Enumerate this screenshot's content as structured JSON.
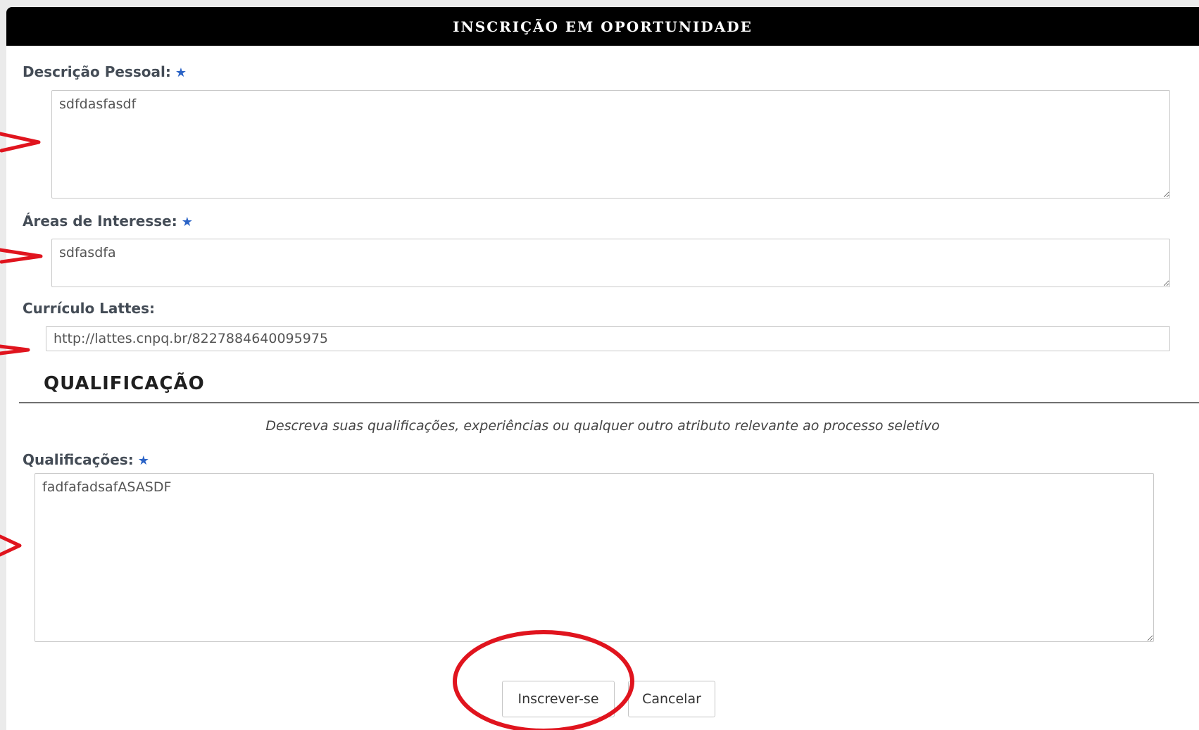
{
  "header": {
    "title": "INSCRIÇÃO EM OPORTUNIDADE"
  },
  "form": {
    "personal_description": {
      "label": "Descrição Pessoal:",
      "required_mark": "★",
      "value": "sdfdasfasdf"
    },
    "areas_of_interest": {
      "label": "Áreas de Interesse:",
      "required_mark": "★",
      "value": "sdfasdfa"
    },
    "lattes": {
      "label": "Currículo Lattes:",
      "value": "http://lattes.cnpq.br/8227884640095975"
    },
    "qualification_section": {
      "title": "QUALIFICAÇÃO",
      "note": "Descreva suas qualificações, experiências ou qualquer outro atributo relevante ao processo seletivo"
    },
    "qualifications": {
      "label": "Qualificações:",
      "required_mark": "★",
      "value": "fadfafadsafASASDF"
    }
  },
  "actions": {
    "subscribe_label": "Inscrever-se",
    "cancel_label": "Cancelar"
  },
  "annotations": {
    "color": "#e0141e"
  },
  "colors": {
    "header_bg": "#000000",
    "label": "#444c56",
    "required_star": "#2a63c6"
  }
}
